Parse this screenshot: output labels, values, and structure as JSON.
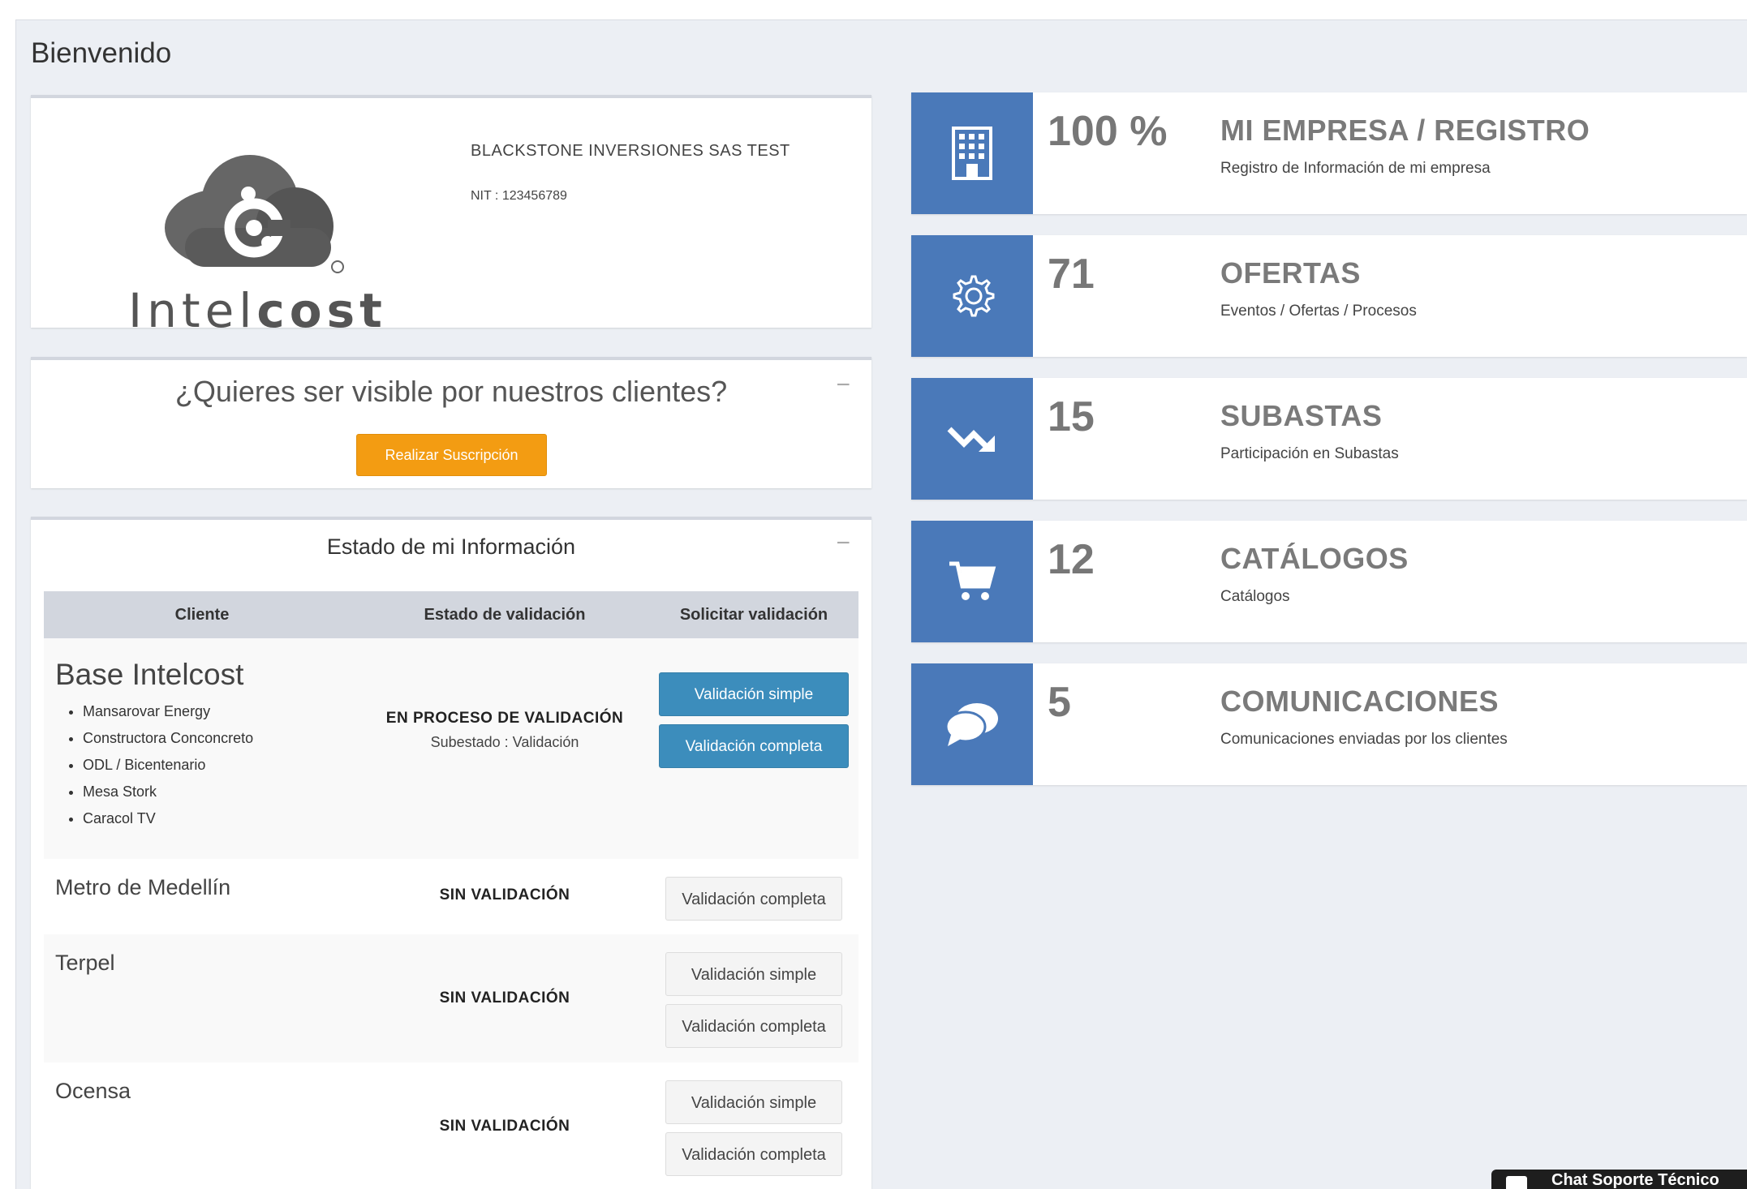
{
  "page": {
    "title": "Bienvenido"
  },
  "company": {
    "logo_text_light": "Intel",
    "logo_text_bold": "cost",
    "name": "BLACKSTONE INVERSIONES SAS TEST",
    "nit": "NIT : 123456789"
  },
  "visibility": {
    "title": "¿Quieres ser visible por nuestros clientes?",
    "collapse": "−",
    "button": "Realizar Suscripción"
  },
  "status": {
    "title": "Estado de mi Información",
    "collapse": "−",
    "headers": [
      "Cliente",
      "Estado de validación",
      "Solicitar validación"
    ],
    "rows": [
      {
        "client": "Base Intelcost",
        "sub_clients": [
          "Mansarovar Energy",
          "Constructora Conconcreto",
          "ODL / Bicentenario",
          "Mesa Stork",
          "Caracol TV"
        ],
        "state": "EN PROCESO DE VALIDACIÓN",
        "substate": "Subestado : Validación",
        "buttons": [
          "Validación simple",
          "Validación completa"
        ]
      },
      {
        "client": "Metro de Medellín",
        "state": "SIN VALIDACIÓN",
        "buttons": [
          "Validación completa"
        ]
      },
      {
        "client": "Terpel",
        "state": "SIN VALIDACIÓN",
        "buttons": [
          "Validación simple",
          "Validación completa"
        ]
      },
      {
        "client": "Ocensa",
        "state": "SIN VALIDACIÓN",
        "buttons": [
          "Validación simple",
          "Validación completa"
        ]
      }
    ]
  },
  "info_boxes": [
    {
      "icon": "building-icon",
      "number": "100 %",
      "title": "MI EMPRESA / REGISTRO",
      "subtitle": "Registro de Información de mi empresa"
    },
    {
      "icon": "gear-icon",
      "number": "71",
      "title": "OFERTAS",
      "subtitle": "Eventos / Ofertas / Procesos"
    },
    {
      "icon": "trending-down-icon",
      "number": "15",
      "title": "SUBASTAS",
      "subtitle": "Participación en Subastas"
    },
    {
      "icon": "cart-icon",
      "number": "12",
      "title": "CATÁLOGOS",
      "subtitle": "Catálogos"
    },
    {
      "icon": "chat-icon",
      "number": "5",
      "title": "COMUNICACIONES",
      "subtitle": "Comunicaciones enviadas por los clientes"
    }
  ],
  "chat": {
    "label": "Chat Soporte Técnico"
  },
  "colors": {
    "icon_bg": "#4a79b9",
    "primary_button": "#3c8dbc",
    "warning_button": "#f39c12",
    "page_bg": "#eceff4"
  }
}
